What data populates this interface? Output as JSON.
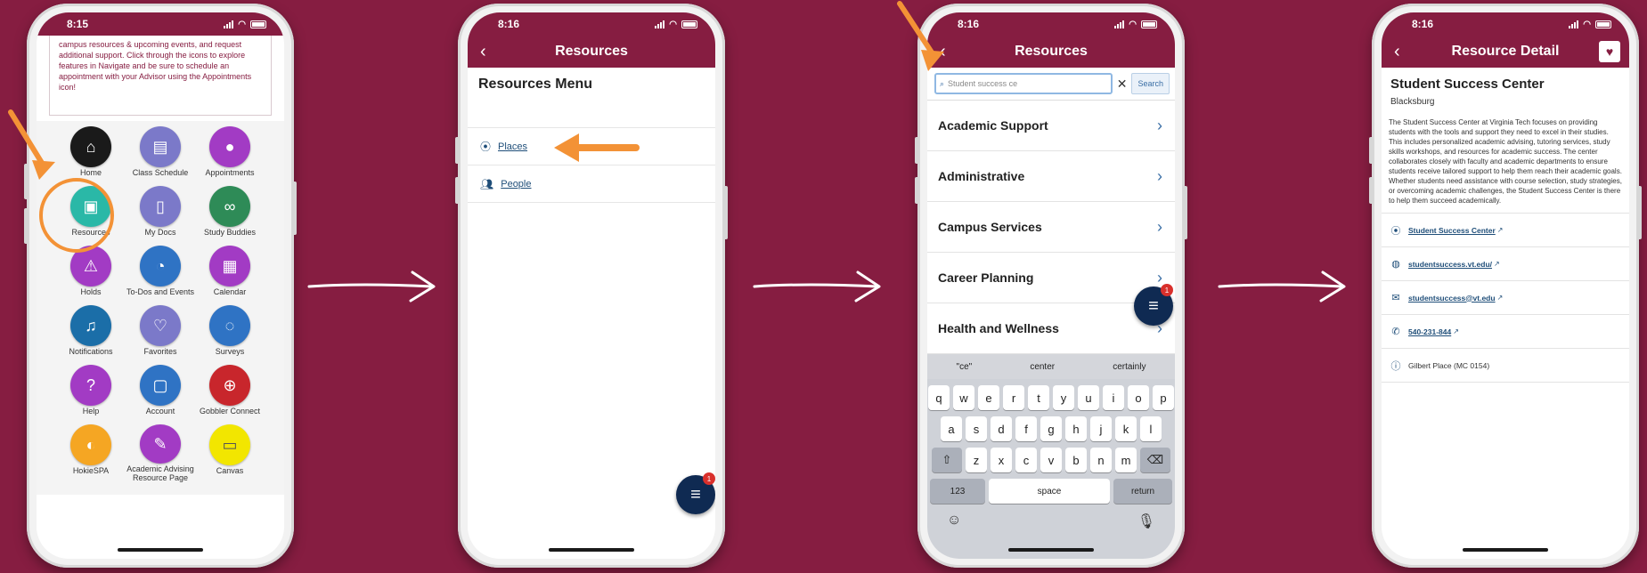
{
  "colors": {
    "background": "#861d41",
    "accent": "#861d41",
    "link": "#1f4e79",
    "fab": "#0f2a52"
  },
  "screen1": {
    "time": "8:15",
    "intro_text": "campus resources & upcoming events, and request additional support. Click through the icons to explore features in Navigate and be sure to schedule an appointment with your Advisor using the Appointments icon!",
    "tiles": [
      {
        "label": "Home",
        "icon": "home-icon",
        "color": "#1a1a1a",
        "glyph": "⌂"
      },
      {
        "label": "Class Schedule",
        "icon": "class-schedule-icon",
        "color": "#7b79c9",
        "glyph": "▤"
      },
      {
        "label": "Appointments",
        "icon": "appointments-icon",
        "color": "#a23bc4",
        "glyph": "●"
      },
      {
        "label": "Resources",
        "icon": "resources-icon",
        "color": "#2ab8a7",
        "glyph": "▣"
      },
      {
        "label": "My Docs",
        "icon": "my-docs-icon",
        "color": "#7b79c9",
        "glyph": "▯"
      },
      {
        "label": "Study Buddies",
        "icon": "study-buddies-icon",
        "color": "#2e8b57",
        "glyph": "∞"
      },
      {
        "label": "Holds",
        "icon": "holds-icon",
        "color": "#a23bc4",
        "glyph": "⚠"
      },
      {
        "label": "To-Dos and Events",
        "icon": "to-dos-icon",
        "color": "#2f73c4",
        "glyph": "◔"
      },
      {
        "label": "Calendar",
        "icon": "calendar-icon",
        "color": "#a23bc4",
        "glyph": "▦"
      },
      {
        "label": "Notifications",
        "icon": "bell-icon",
        "color": "#1b6ea8",
        "glyph": "♫"
      },
      {
        "label": "Favorites",
        "icon": "heart-icon",
        "color": "#7b79c9",
        "glyph": "♡"
      },
      {
        "label": "Surveys",
        "icon": "surveys-icon",
        "color": "#2f73c4",
        "glyph": "◌"
      },
      {
        "label": "Help",
        "icon": "help-icon",
        "color": "#a23bc4",
        "glyph": "?"
      },
      {
        "label": "Account",
        "icon": "account-icon",
        "color": "#2f73c4",
        "glyph": "▢"
      },
      {
        "label": "Gobbler Connect",
        "icon": "gobbler-connect-icon",
        "color": "#c8262c",
        "glyph": "⊕"
      },
      {
        "label": "HokieSPA",
        "icon": "hokiespa-icon",
        "color": "#f5a623",
        "glyph": "◐"
      },
      {
        "label": "Academic Advising Resource Page",
        "icon": "advising-icon",
        "color": "#a23bc4",
        "glyph": "✎"
      },
      {
        "label": "Canvas",
        "icon": "canvas-icon",
        "color": "#f2e600",
        "glyph": "▭"
      }
    ]
  },
  "screen2": {
    "time": "8:16",
    "title": "Resources",
    "menu_title": "Resources Menu",
    "items": [
      {
        "label": "Places",
        "icon": "location-pin-icon"
      },
      {
        "label": "People",
        "icon": "people-icon"
      }
    ],
    "fab_badge": "1"
  },
  "screen3": {
    "time": "8:16",
    "title": "Resources",
    "search_value": "Student success ce",
    "search_button": "Search",
    "categories": [
      "Academic Support",
      "Administrative",
      "Campus Services",
      "Career Planning",
      "Health and Wellness"
    ],
    "fab_badge": "1",
    "suggestions": [
      "\"ce\"",
      "center",
      "certainly"
    ],
    "keys_row1": [
      "q",
      "w",
      "e",
      "r",
      "t",
      "y",
      "u",
      "i",
      "o",
      "p"
    ],
    "keys_row2": [
      "a",
      "s",
      "d",
      "f",
      "g",
      "h",
      "j",
      "k",
      "l"
    ],
    "keys_row3": [
      "z",
      "x",
      "c",
      "v",
      "b",
      "n",
      "m"
    ],
    "key_num": "123",
    "key_space": "space",
    "key_return": "return"
  },
  "screen4": {
    "time": "8:16",
    "title": "Resource Detail",
    "name": "Student Success Center",
    "location": "Blacksburg",
    "description": "The Student Success Center at Virginia Tech focuses on providing students with the tools and support they need to excel in their studies. This includes personalized academic advising, tutoring services, study skills workshops, and resources for academic success. The center collaborates closely with faculty and academic departments to ensure students receive tailored support to help them reach their academic goals. Whether students need assistance with course selection, study strategies, or overcoming academic challenges, the Student Success Center is there to help them succeed academically.",
    "details": [
      {
        "text": "Student Success Center",
        "icon": "location-pin-icon",
        "link": true
      },
      {
        "text": "studentsuccess.vt.edu/",
        "icon": "globe-icon",
        "link": true
      },
      {
        "text": "studentsuccess@vt.edu",
        "icon": "mail-icon",
        "link": true
      },
      {
        "text": "540-231-844",
        "icon": "phone-icon",
        "link": true
      },
      {
        "text": "Gilbert Place (MC 0154)",
        "icon": "info-icon",
        "link": false
      }
    ]
  }
}
